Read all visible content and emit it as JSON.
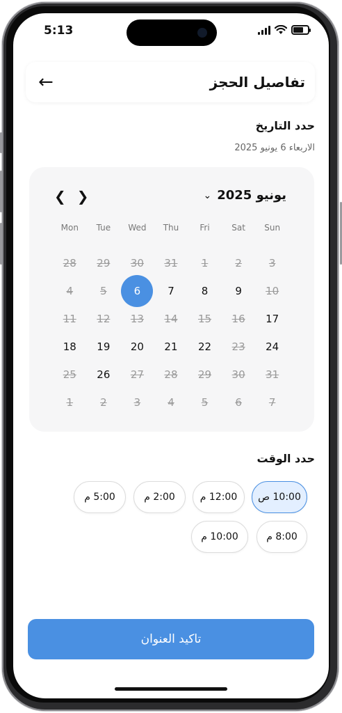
{
  "status_bar": {
    "time": "5:13"
  },
  "header": {
    "title": "تفاصيل الحجز",
    "back_icon": "arrow-left-icon"
  },
  "date_section": {
    "title": "حدد التاريخ",
    "selected_date": "الاربعاء 6 يونيو 2025"
  },
  "calendar": {
    "month_label": "يونيو 2025",
    "weekdays": [
      "Mon",
      "Tue",
      "Wed",
      "Thu",
      "Fri",
      "Sat",
      "Sun"
    ],
    "weeks": [
      [
        {
          "d": "28",
          "s": "disabled"
        },
        {
          "d": "29",
          "s": "disabled"
        },
        {
          "d": "30",
          "s": "disabled"
        },
        {
          "d": "31",
          "s": "disabled"
        },
        {
          "d": "1",
          "s": "disabled"
        },
        {
          "d": "2",
          "s": "disabled"
        },
        {
          "d": "3",
          "s": "disabled"
        }
      ],
      [
        {
          "d": "4",
          "s": "disabled"
        },
        {
          "d": "5",
          "s": "disabled"
        },
        {
          "d": "6",
          "s": "selected"
        },
        {
          "d": "7",
          "s": "available"
        },
        {
          "d": "8",
          "s": "available"
        },
        {
          "d": "9",
          "s": "available"
        },
        {
          "d": "10",
          "s": "disabled"
        }
      ],
      [
        {
          "d": "11",
          "s": "disabled"
        },
        {
          "d": "12",
          "s": "disabled"
        },
        {
          "d": "13",
          "s": "disabled"
        },
        {
          "d": "14",
          "s": "disabled"
        },
        {
          "d": "15",
          "s": "disabled"
        },
        {
          "d": "16",
          "s": "disabled"
        },
        {
          "d": "17",
          "s": "available"
        }
      ],
      [
        {
          "d": "18",
          "s": "available"
        },
        {
          "d": "19",
          "s": "available"
        },
        {
          "d": "20",
          "s": "available"
        },
        {
          "d": "21",
          "s": "available"
        },
        {
          "d": "22",
          "s": "available"
        },
        {
          "d": "23",
          "s": "disabled"
        },
        {
          "d": "24",
          "s": "available"
        }
      ],
      [
        {
          "d": "25",
          "s": "disabled"
        },
        {
          "d": "26",
          "s": "available"
        },
        {
          "d": "27",
          "s": "disabled"
        },
        {
          "d": "28",
          "s": "disabled"
        },
        {
          "d": "29",
          "s": "disabled"
        },
        {
          "d": "30",
          "s": "disabled"
        },
        {
          "d": "31",
          "s": "disabled"
        }
      ],
      [
        {
          "d": "1",
          "s": "disabled"
        },
        {
          "d": "2",
          "s": "disabled"
        },
        {
          "d": "3",
          "s": "disabled"
        },
        {
          "d": "4",
          "s": "disabled"
        },
        {
          "d": "5",
          "s": "disabled"
        },
        {
          "d": "6",
          "s": "disabled"
        },
        {
          "d": "7",
          "s": "disabled"
        }
      ]
    ]
  },
  "time_section": {
    "title": "حدد الوقت",
    "slots": [
      {
        "label": "10:00 ص",
        "active": true
      },
      {
        "label": "12:00 م",
        "active": false
      },
      {
        "label": "2:00 م",
        "active": false
      },
      {
        "label": "5:00 م",
        "active": false
      },
      {
        "label": "8:00 م",
        "active": false
      },
      {
        "label": "10:00 م",
        "active": false
      }
    ]
  },
  "confirm_button": {
    "label": "تاكيد العنوان"
  },
  "colors": {
    "accent": "#4a90e2",
    "calendar_bg": "#f6f6f7",
    "active_slot_bg": "#e3efff"
  }
}
